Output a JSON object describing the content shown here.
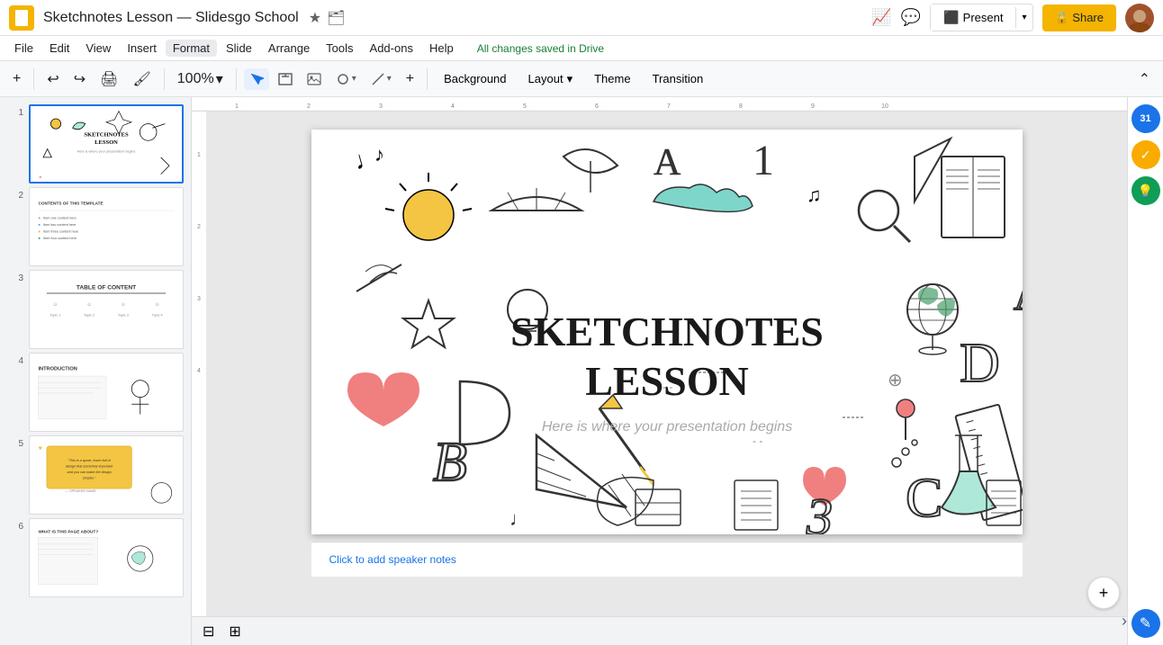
{
  "titleBar": {
    "appName": "Sketchnotes Lesson — Slidesgo School",
    "starLabel": "★",
    "folderLabel": "🗂",
    "presentLabel": "Present",
    "shareLabel": "🔒 Share"
  },
  "menuBar": {
    "items": [
      "File",
      "Edit",
      "View",
      "Insert",
      "Format",
      "Slide",
      "Arrange",
      "Tools",
      "Add-ons",
      "Help"
    ],
    "savedStatus": "All changes saved in Drive"
  },
  "toolbar": {
    "addSlide": "+",
    "undo": "↩",
    "redo": "↪",
    "print": "🖨",
    "paintFormat": "🖌",
    "zoom": "100%",
    "select": "↖",
    "textBox": "T",
    "image": "🖼",
    "shapes": "◯",
    "line": "╱",
    "more": "+",
    "backgroundBtn": "Background",
    "layoutBtn": "Layout",
    "layoutCaret": "▾",
    "themeBtn": "Theme",
    "transitionBtn": "Transition",
    "collapseBtn": "⌃"
  },
  "slidePanel": {
    "slides": [
      {
        "num": 1,
        "active": true,
        "label": "Sketchnotes title slide"
      },
      {
        "num": 2,
        "active": false,
        "label": "Contents slide"
      },
      {
        "num": 3,
        "active": false,
        "label": "Table of contents"
      },
      {
        "num": 4,
        "active": false,
        "label": "Introduction slide"
      },
      {
        "num": 5,
        "active": false,
        "label": "Quote slide"
      },
      {
        "num": 6,
        "active": false,
        "label": "What is this slide"
      }
    ]
  },
  "mainSlide": {
    "title": "SKETCHNOTES\nLESSON",
    "subtitle": "Here is where your presentation begins"
  },
  "speakerNotes": {
    "placeholder": "Click to add speaker notes"
  },
  "bottomBar": {
    "gridView": "⊞",
    "listView": "☰"
  },
  "rightSidebar": {
    "calendarIcon": "31",
    "tasksIcon": "✓",
    "keepIcon": "💡",
    "editIcon": "✎",
    "expandIcon": "›"
  }
}
